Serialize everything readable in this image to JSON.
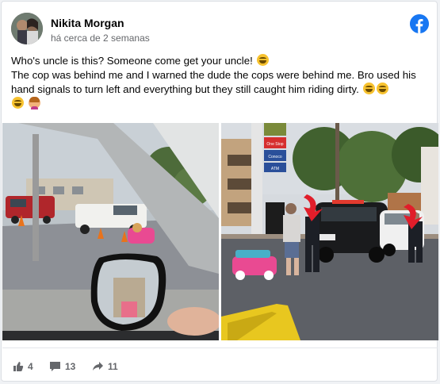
{
  "post": {
    "author": "Nikita Morgan",
    "timestamp": "há cerca de 2 semanas",
    "line1": "Who's uncle is this? Someone come get your uncle!",
    "line2": "The cop was behind me and I warned the dude the cops were behind me. Bro used his hand signals to turn left and everything but they still caught him riding dirty."
  },
  "photo_left": {
    "alt_scene": "car-side-mirror-view-of-kids-ride-on-car"
  },
  "photo_right": {
    "store_sign_top": "One Stop",
    "store_sign_mid": "Conoco",
    "store_sign_bottom": "ATM"
  },
  "stats": {
    "likes": "4",
    "comments": "13",
    "shares": "11"
  },
  "colors": {
    "brand": "#1877f2",
    "text": "#050505",
    "muted": "#65676b"
  },
  "icons": [
    "facebook-icon",
    "like-icon",
    "comment-icon",
    "share-icon",
    "laughing-emoji",
    "woman-shrugging-emoji"
  ]
}
